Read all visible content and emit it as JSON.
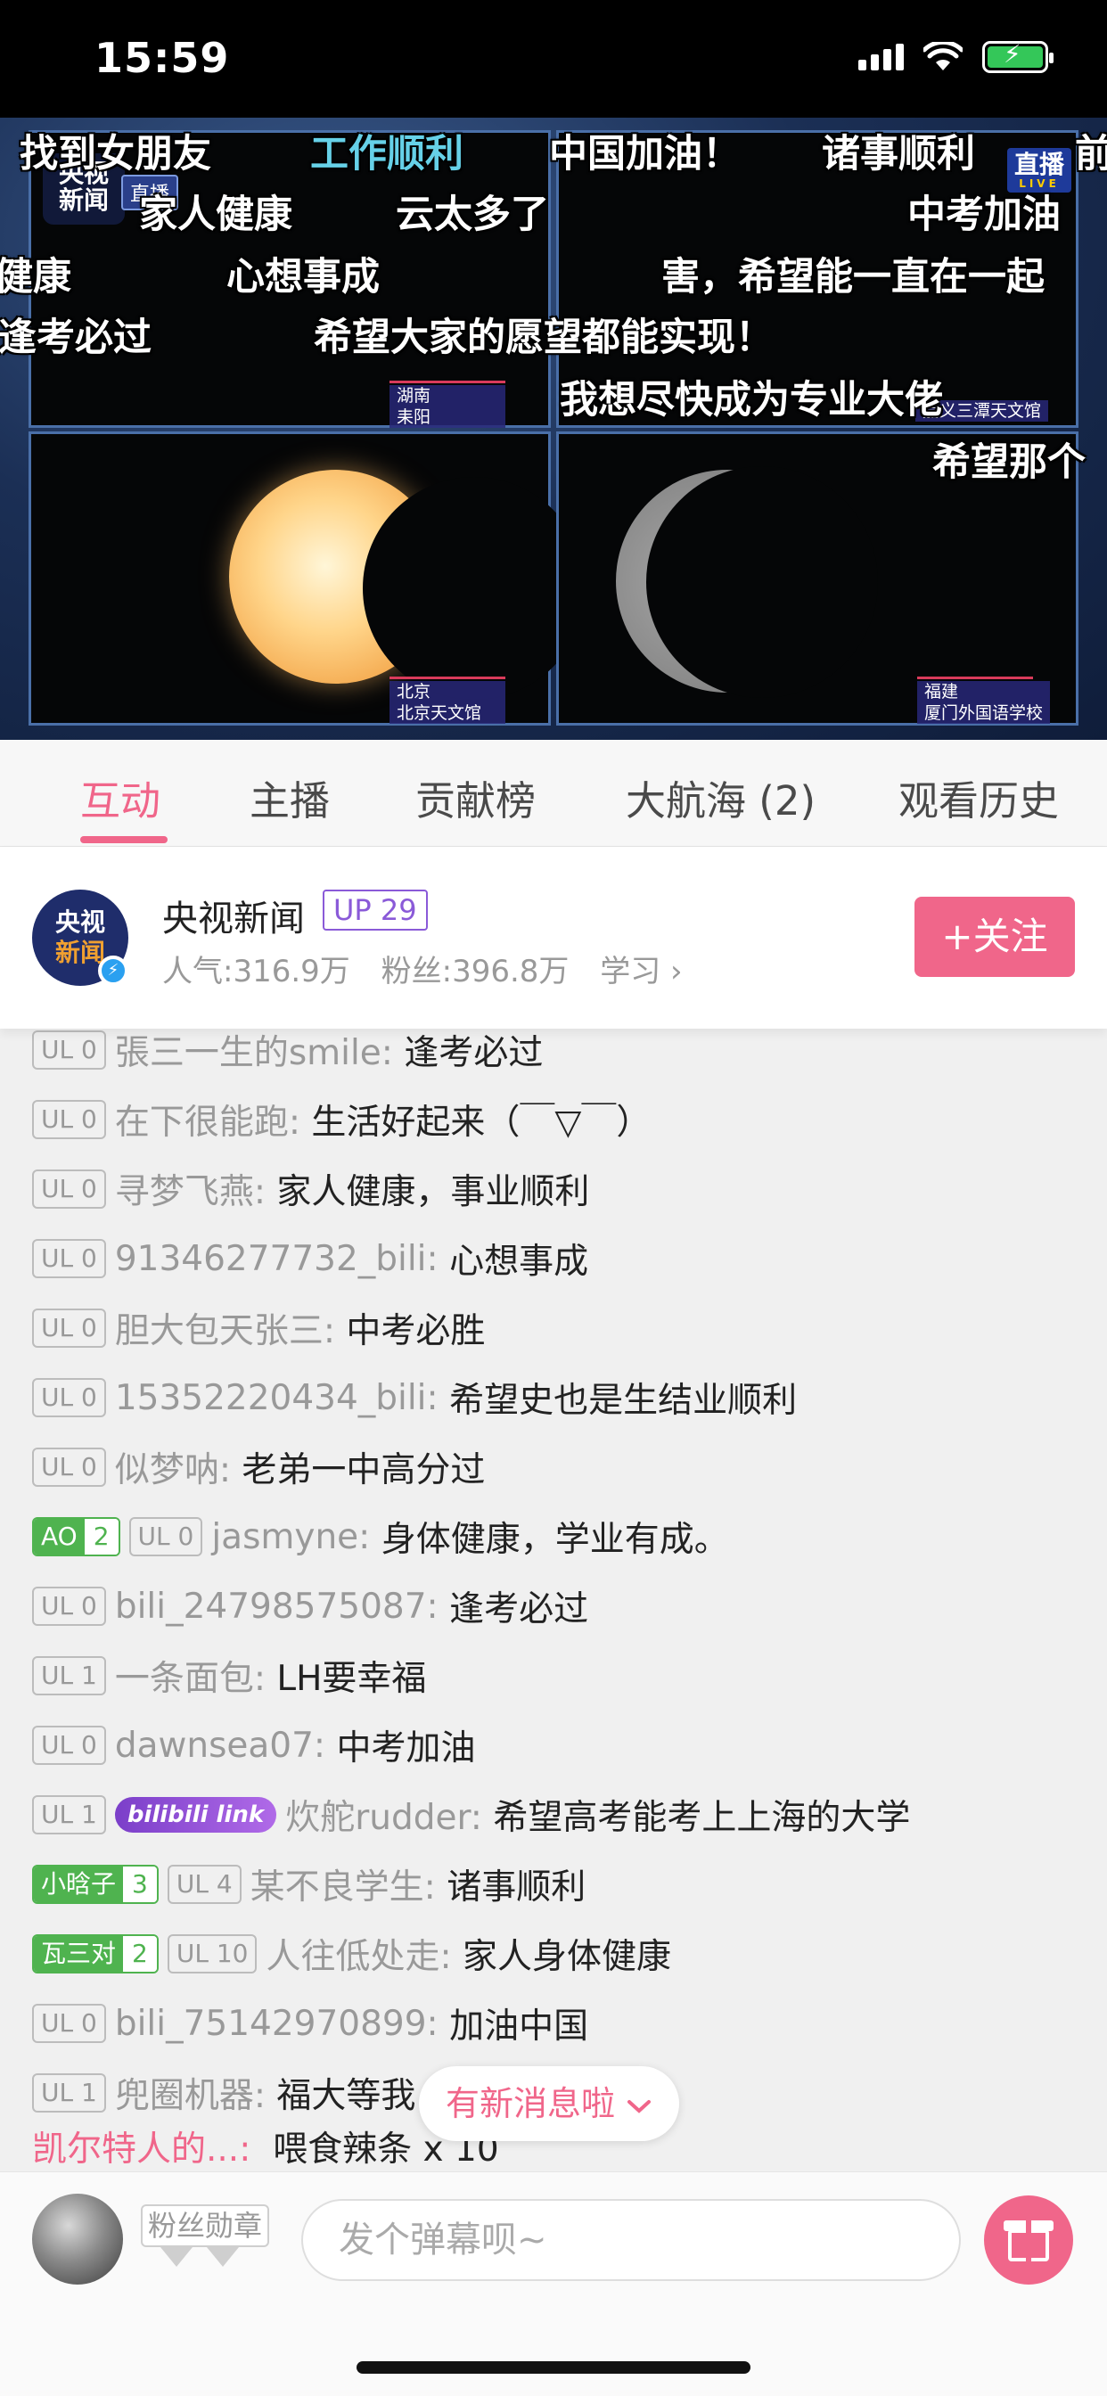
{
  "status": {
    "time": "15:59"
  },
  "video": {
    "logo": "央视\n新闻",
    "live_badge": "直播",
    "live_tr": "直播",
    "live_tr_sub": "LIVE",
    "locations": [
      {
        "line1": "湖南",
        "line2": "耒阳"
      },
      {
        "line1": "",
        "line2": "嘉义三潭天文馆"
      },
      {
        "line1": "北京",
        "line2": "北京天文馆"
      },
      {
        "line1": "福建",
        "line2": "厦门外国语学校"
      }
    ],
    "danmaku": [
      {
        "text": "找到女朋友",
        "cyan": false
      },
      {
        "text": "工作顺利",
        "cyan": true
      },
      {
        "text": "中国加油！",
        "cyan": false
      },
      {
        "text": "诸事顺利",
        "cyan": false
      },
      {
        "text": "前",
        "cyan": false
      },
      {
        "text": "家人健康",
        "cyan": false
      },
      {
        "text": "云太多了",
        "cyan": false
      },
      {
        "text": "中考加油",
        "cyan": false
      },
      {
        "text": "健康",
        "cyan": false
      },
      {
        "text": "心想事成",
        "cyan": false
      },
      {
        "text": "害，希望能一直在一起",
        "cyan": false
      },
      {
        "text": "逢考必过",
        "cyan": false
      },
      {
        "text": "希望大家的愿望都能实现！",
        "cyan": false
      },
      {
        "text": "我想尽快成为专业大佬",
        "cyan": false
      },
      {
        "text": "希望那个",
        "cyan": false
      }
    ]
  },
  "tabs": [
    {
      "label": "互动",
      "active": true
    },
    {
      "label": "主播",
      "active": false
    },
    {
      "label": "贡献榜",
      "active": false
    },
    {
      "label": "大航海 (2)",
      "active": false
    },
    {
      "label": "观看历史",
      "active": false
    }
  ],
  "host": {
    "avatar_line1": "央视",
    "avatar_line2": "新闻",
    "name": "央视新闻",
    "level": "UP 29",
    "popularity": "人气:316.9万",
    "fans": "粉丝:396.8万",
    "category": "学习",
    "follow_label": "+关注"
  },
  "messages": [
    {
      "ul": "UL 0",
      "user": "張三一生的smile:",
      "text": "逢考必过"
    },
    {
      "ul": "UL 0",
      "user": "在下很能跑:",
      "text": "生活好起来（￣▽￣）"
    },
    {
      "ul": "UL 0",
      "user": "寻梦飞燕:",
      "text": "家人健康，事业顺利"
    },
    {
      "ul": "UL 0",
      "user": "91346277732_bili:",
      "text": "心想事成"
    },
    {
      "ul": "UL 0",
      "user": "胆大包天张三:",
      "text": "中考必胜"
    },
    {
      "ul": "UL 0",
      "user": "15352220434_bili:",
      "text": "希望史也是生结业顺利"
    },
    {
      "ul": "UL 0",
      "user": "似梦呐:",
      "text": "老弟一中高分过"
    },
    {
      "medal_name": "AO",
      "medal_level": "2",
      "ul": "UL 0",
      "user": "jasmyne:",
      "text": "身体健康，学业有成。"
    },
    {
      "ul": "UL 0",
      "user": "bili_24798575087:",
      "text": "逢考必过"
    },
    {
      "ul": "UL 1",
      "user": "一条面包:",
      "text": "LH要幸福"
    },
    {
      "ul": "UL 0",
      "user": "dawnsea07:",
      "text": "中考加油"
    },
    {
      "ul": "UL 1",
      "badge": "bilibili link",
      "user": "炊舵rudder:",
      "text": "希望高考能考上上海的大学"
    },
    {
      "medal_name": "小晗子",
      "medal_level": "3",
      "ul": "UL 4",
      "user": "某不良学生:",
      "text": "诸事顺利"
    },
    {
      "medal_name": "瓦三对",
      "medal_level": "2",
      "ul": "UL 10",
      "user": "人往低处走:",
      "text": "家人身体健康"
    },
    {
      "ul": "UL 0",
      "user": "bili_75142970899:",
      "text": "加油中国"
    },
    {
      "ul": "UL 1",
      "user": "兜圈机器:",
      "text": "福大等我"
    }
  ],
  "gift_line": {
    "user": "凯尔特人的...:",
    "text": "喂食辣条 x 10"
  },
  "new_message_label": "有新消息啦",
  "bottom": {
    "fan_medal_label": "粉丝勋章",
    "input_placeholder": "发个弹幕呗~"
  },
  "colors": {
    "accent": "#f0668a",
    "medal_green": "#4fb34f",
    "up_purple": "#8a5ad8"
  }
}
